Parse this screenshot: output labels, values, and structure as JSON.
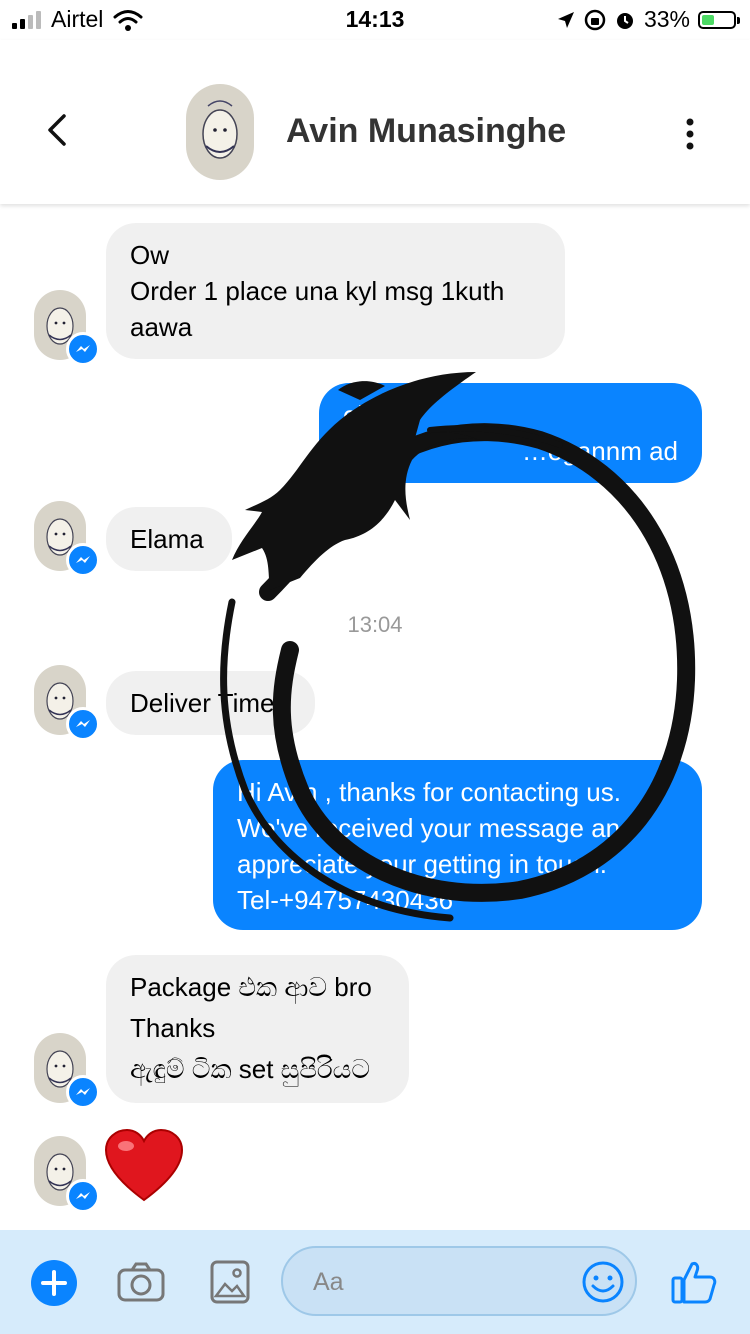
{
  "status_bar": {
    "carrier": "Airtel",
    "time": "14:13",
    "battery": "33%"
  },
  "header": {
    "contact_name": "Avin Munasinghe"
  },
  "messages": [
    {
      "direction": "incoming",
      "lines": [
        "Ow",
        "Order 1 place una kyl msg 1kuth",
        "aawa"
      ]
    },
    {
      "direction": "outgoing",
      "lines": [
        "ok bro",
        "…egannm ad"
      ]
    },
    {
      "direction": "incoming",
      "lines": [
        "Elama"
      ]
    },
    {
      "direction": "incoming",
      "lines": [
        "Deliver Time"
      ]
    },
    {
      "direction": "outgoing",
      "lines": [
        "Hi Avin , thanks for contacting us.",
        "We've received your message and",
        "appreciate your getting in touch.",
        "Tel-+94757430436"
      ]
    },
    {
      "direction": "incoming",
      "lines": [
        "Package එක ආව bro",
        "Thanks",
        "ඇඳුම් ටික set සුපිරියට"
      ]
    },
    {
      "direction": "incoming",
      "emoji": "❤️"
    }
  ],
  "timestamp": "13:04",
  "composer": {
    "placeholder": "Aa"
  },
  "colors": {
    "accent": "#0a84ff",
    "incoming_bubble": "#f0f0f0",
    "input_bar": "#d6ebfb"
  },
  "icons": [
    "back-chevron-icon",
    "more-vertical-icon",
    "plus-icon",
    "camera-icon",
    "image-icon",
    "emoji-icon",
    "thumbs-up-icon",
    "messenger-badge-icon"
  ]
}
